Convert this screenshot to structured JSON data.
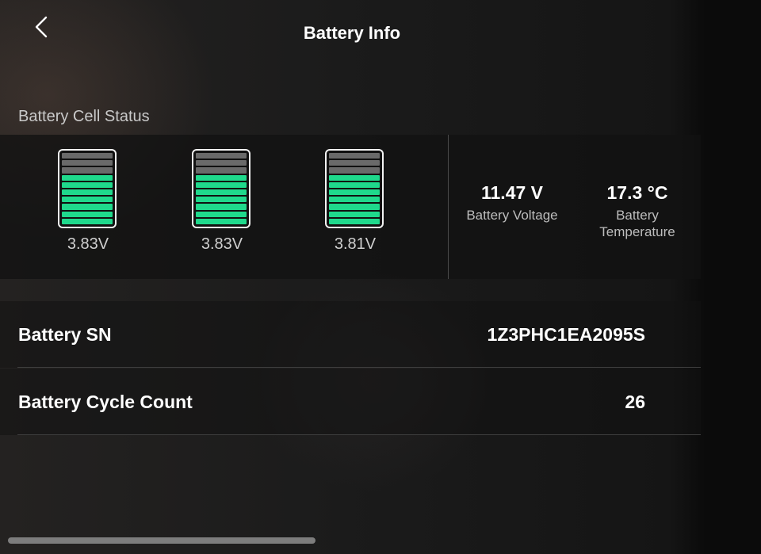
{
  "header": {
    "title": "Battery Info"
  },
  "cells_section": {
    "label": "Battery Cell Status",
    "cells": [
      {
        "voltage": "3.83V",
        "total_segments": 10,
        "filled_segments": 7
      },
      {
        "voltage": "3.83V",
        "total_segments": 10,
        "filled_segments": 7
      },
      {
        "voltage": "3.81V",
        "total_segments": 10,
        "filled_segments": 7
      }
    ]
  },
  "stats": {
    "voltage": {
      "value": "11.47 V",
      "label": "Battery Voltage"
    },
    "temperature": {
      "value": "17.3 °C",
      "label_line1": "Battery",
      "label_line2": "Temperature"
    }
  },
  "rows": {
    "serial": {
      "label": "Battery SN",
      "value": "1Z3PHC1EA2095S"
    },
    "cycle": {
      "label": "Battery Cycle Count",
      "value": "26"
    }
  },
  "colors": {
    "cell_fill": "#1fd98c",
    "cell_empty": "#6a6a6a",
    "accent_text": "#ffffff"
  },
  "icons": {
    "back": "chevron-left-icon",
    "cell": "battery-cell-icon"
  }
}
